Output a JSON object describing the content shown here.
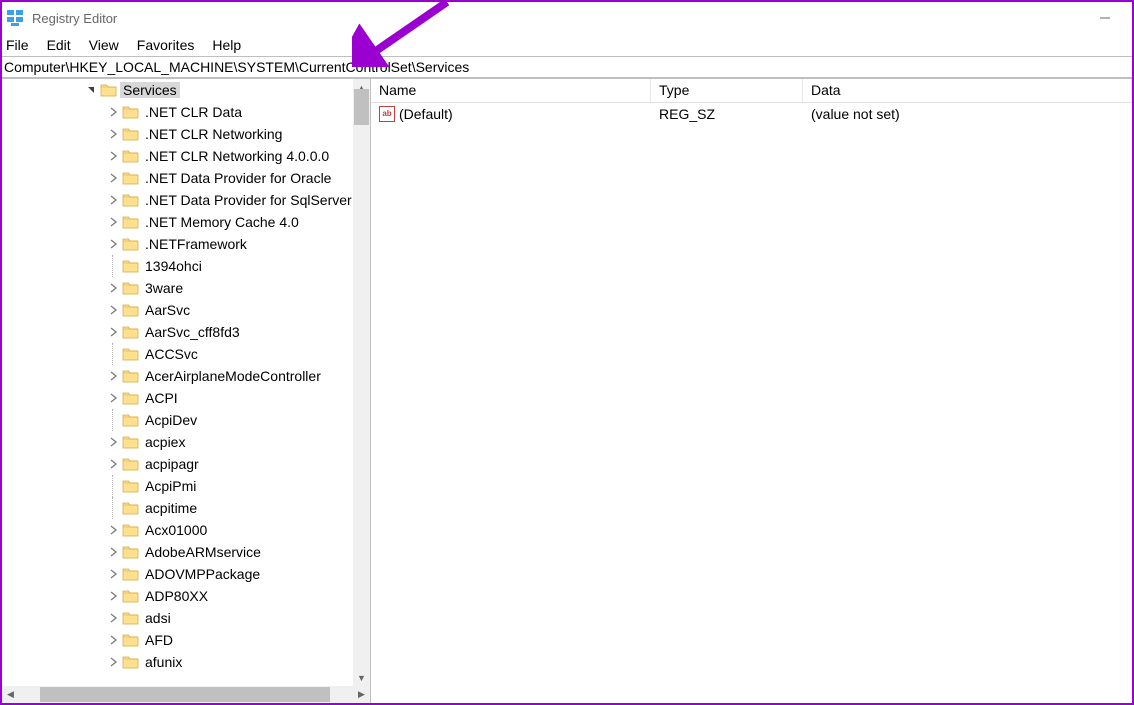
{
  "window": {
    "title": "Registry Editor"
  },
  "menu": {
    "items": [
      "File",
      "Edit",
      "View",
      "Favorites",
      "Help"
    ]
  },
  "address": {
    "path": "Computer\\HKEY_LOCAL_MACHINE\\SYSTEM\\CurrentControlSet\\Services"
  },
  "tree": {
    "root": {
      "label": "Services",
      "expanded": true,
      "selected": true,
      "hasChildren": true
    },
    "children": [
      {
        "label": ".NET CLR Data",
        "hasChildren": true
      },
      {
        "label": ".NET CLR Networking",
        "hasChildren": true
      },
      {
        "label": ".NET CLR Networking 4.0.0.0",
        "hasChildren": true
      },
      {
        "label": ".NET Data Provider for Oracle",
        "hasChildren": true
      },
      {
        "label": ".NET Data Provider for SqlServer",
        "hasChildren": true
      },
      {
        "label": ".NET Memory Cache 4.0",
        "hasChildren": true
      },
      {
        "label": ".NETFramework",
        "hasChildren": true
      },
      {
        "label": "1394ohci",
        "hasChildren": false
      },
      {
        "label": "3ware",
        "hasChildren": true
      },
      {
        "label": "AarSvc",
        "hasChildren": true
      },
      {
        "label": "AarSvc_cff8fd3",
        "hasChildren": true
      },
      {
        "label": "ACCSvc",
        "hasChildren": false
      },
      {
        "label": "AcerAirplaneModeController",
        "hasChildren": true
      },
      {
        "label": "ACPI",
        "hasChildren": true
      },
      {
        "label": "AcpiDev",
        "hasChildren": false
      },
      {
        "label": "acpiex",
        "hasChildren": true
      },
      {
        "label": "acpipagr",
        "hasChildren": true
      },
      {
        "label": "AcpiPmi",
        "hasChildren": false
      },
      {
        "label": "acpitime",
        "hasChildren": false
      },
      {
        "label": "Acx01000",
        "hasChildren": true
      },
      {
        "label": "AdobeARMservice",
        "hasChildren": true
      },
      {
        "label": "ADOVMPPackage",
        "hasChildren": true
      },
      {
        "label": "ADP80XX",
        "hasChildren": true
      },
      {
        "label": "adsi",
        "hasChildren": true
      },
      {
        "label": "AFD",
        "hasChildren": true
      },
      {
        "label": "afunix",
        "hasChildren": true
      }
    ]
  },
  "list": {
    "columns": {
      "name": "Name",
      "type": "Type",
      "data": "Data"
    },
    "rows": [
      {
        "name": "(Default)",
        "type": "REG_SZ",
        "data": "(value not set)"
      }
    ]
  }
}
